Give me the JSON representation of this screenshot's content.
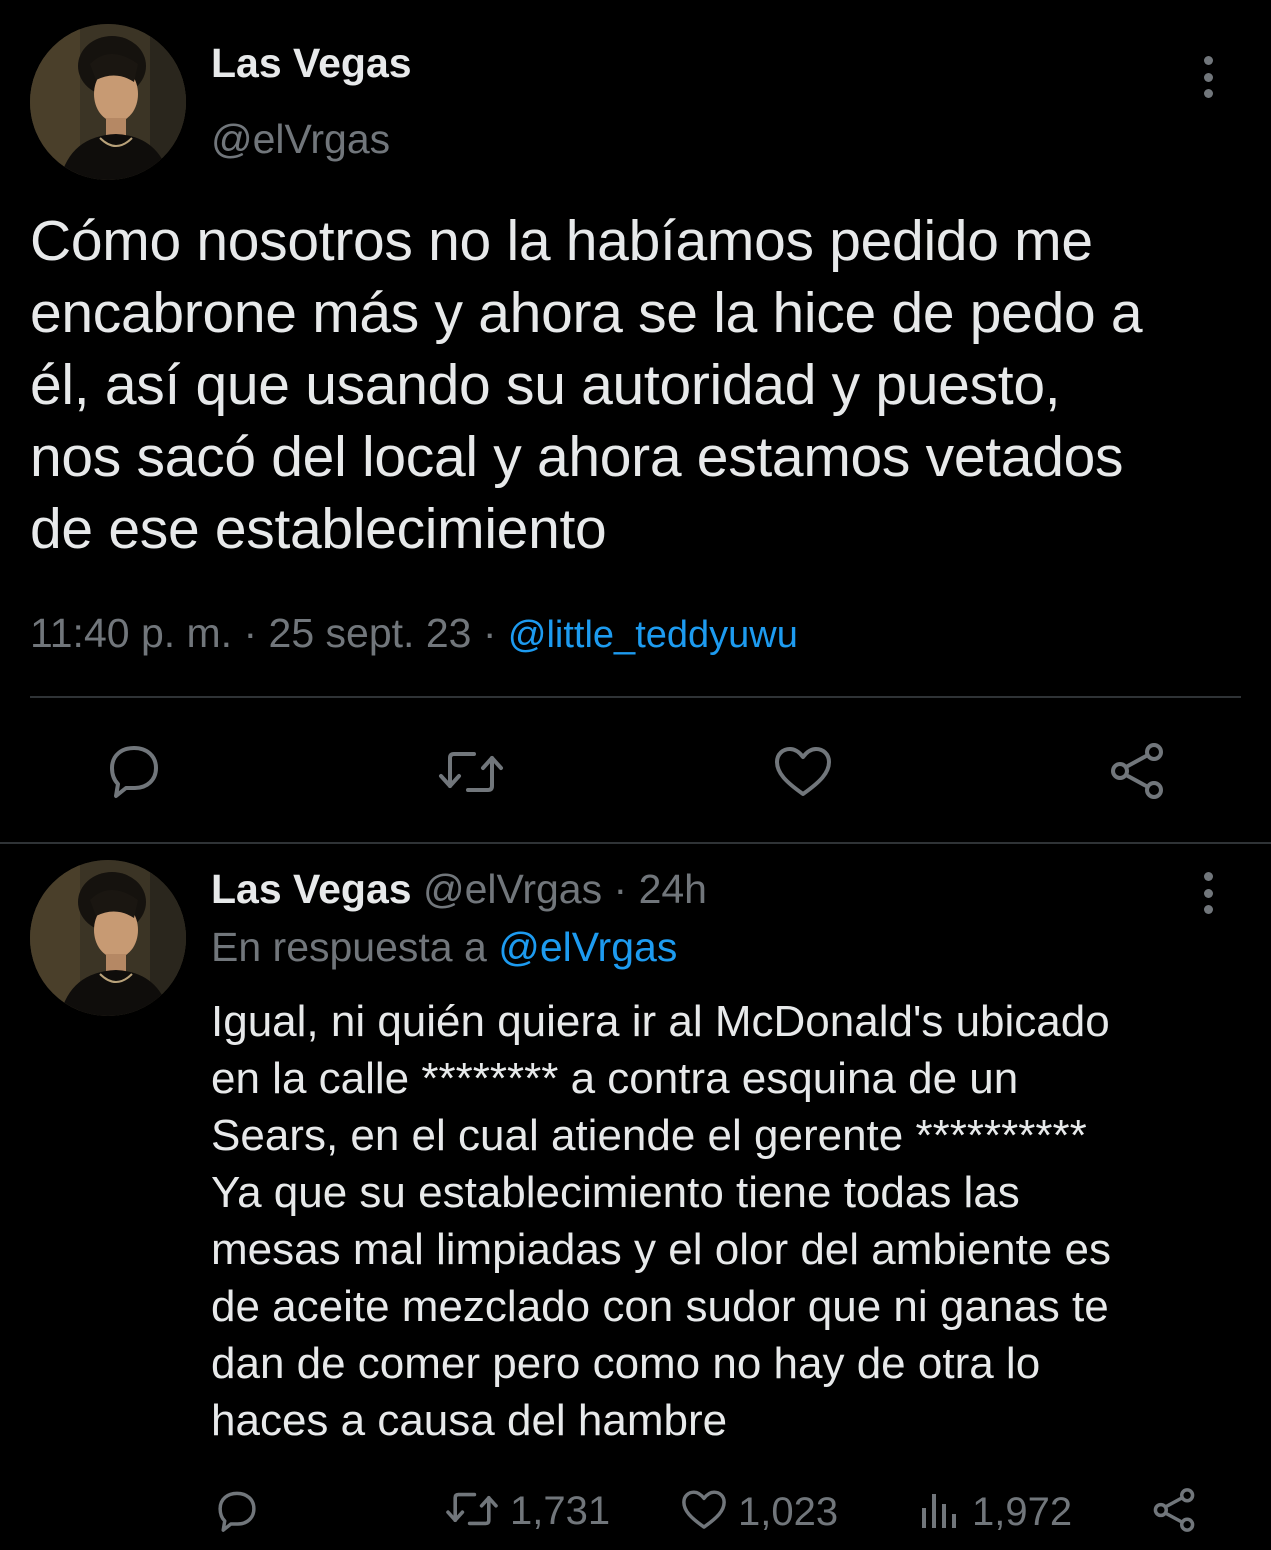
{
  "main_tweet": {
    "author_name": "Las Vegas",
    "author_handle": "@elVrgas",
    "text": "Cómo nosotros no la habíamos pedido me\nencabrone más y ahora se la hice de pedo a\nél, así que usando su autoridad y puesto,\nnos sacó del local y ahora estamos vetados\nde ese establecimiento",
    "time": "11:40 p. m.",
    "separator": "·",
    "date": "25 sept. 23",
    "via": "@little_teddyuwu",
    "icons": [
      "reply-icon",
      "retweet-icon",
      "like-icon",
      "share-icon"
    ]
  },
  "reply_tweet": {
    "author_name": "Las Vegas",
    "author_handle": "@elVrgas",
    "separator": "·",
    "time_ago": "24h",
    "replying_prefix": "En respuesta a",
    "replying_to": "@elVrgas",
    "text": "Igual, ni quién quiera ir al McDonald's ubicado\nen la calle ******** a contra esquina de un\nSears, en el cual atiende el gerente **********\nYa que su establecimiento tiene todas las\nmesas mal limpiadas y el olor del ambiente es\nde aceite mezclado con sudor que ni ganas te\ndan de comer pero como no hay de otra lo\nhaces a causa del hambre",
    "retweets": "1,731",
    "likes": "1,023",
    "views": "1,972",
    "icons": [
      "reply-icon",
      "retweet-icon",
      "like-icon",
      "views-icon",
      "share-icon"
    ]
  },
  "colors": {
    "background": "#000000",
    "text": "#e7e9ea",
    "muted": "#71767b",
    "link": "#1d9bf0",
    "divider": "#2f3336"
  }
}
